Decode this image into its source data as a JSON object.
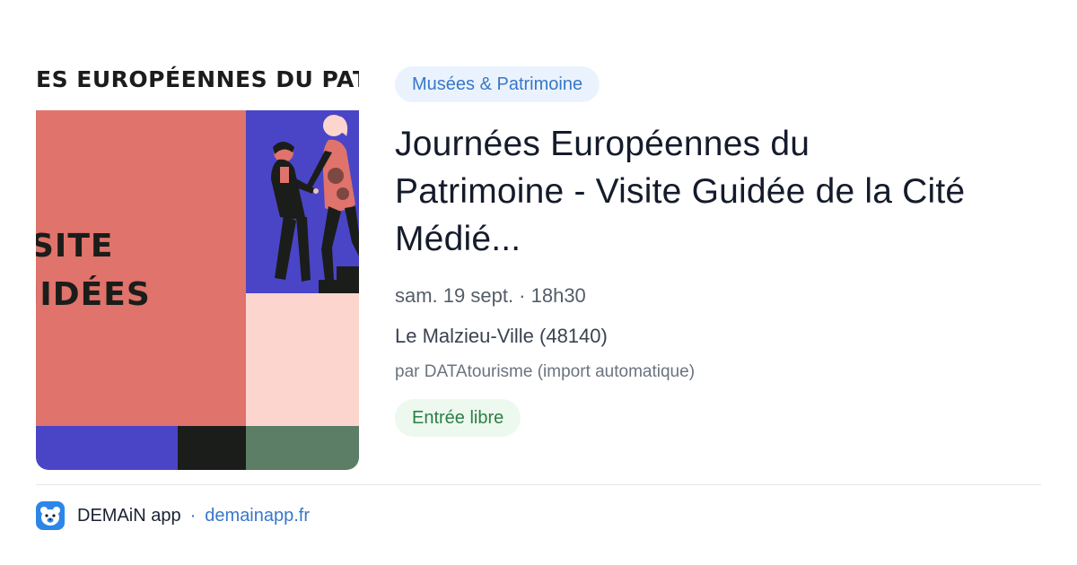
{
  "card": {
    "image": {
      "banner_text": "ES EUROPÉENNES DU PATR",
      "poster_line1": "SITE",
      "poster_line2": "JIDÉES",
      "colors": {
        "salmon": "#e0736b",
        "blue": "#4a45c7",
        "pink": "#fdd5cf",
        "black": "#1b1d1a",
        "green": "#5c7d66"
      }
    },
    "category": "Musées & Patrimoine",
    "title": "Journées Européennes du Patrimoine - Visite Guidée de la Cité Médié...",
    "date": "sam. 19 sept. · 18h30",
    "location": "Le Malzieu-Ville (48140)",
    "source": "par DATAtourisme (import automatique)",
    "price": "Entrée libre"
  },
  "footer": {
    "app_icon": "bear-app-icon",
    "app_name": "DEMAiN app",
    "separator": "·",
    "domain": "demainapp.fr"
  },
  "colors": {
    "accent": "#3877c9",
    "price_green": "#2a8045",
    "category_bg": "#eaf3fd",
    "price_bg": "#edf8ef"
  }
}
